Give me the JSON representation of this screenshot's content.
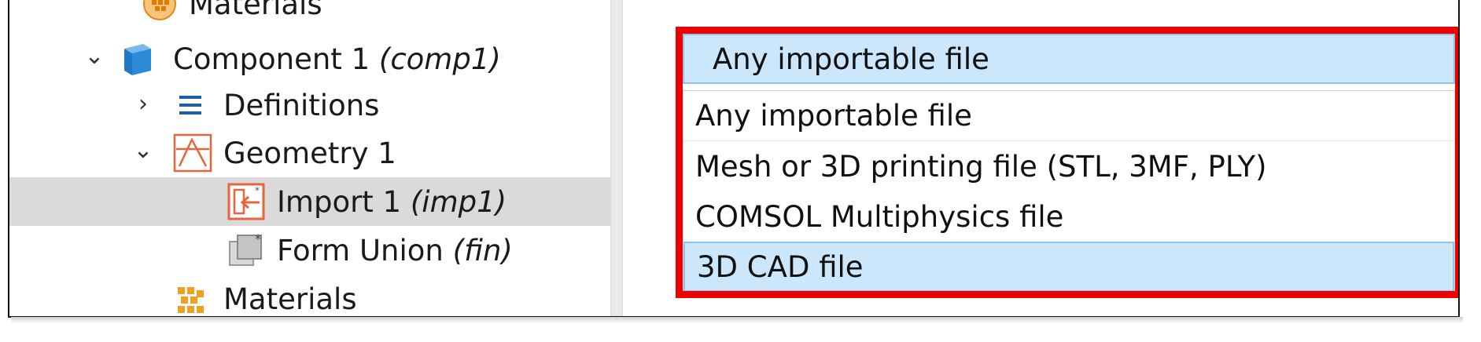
{
  "tree": {
    "items": [
      {
        "label": "Materials",
        "suffix": ""
      },
      {
        "label": "Component 1",
        "suffix": "(comp1)"
      },
      {
        "label": "Definitions",
        "suffix": ""
      },
      {
        "label": "Geometry 1",
        "suffix": ""
      },
      {
        "label": "Import 1",
        "suffix": "(imp1)"
      },
      {
        "label": "Form Union",
        "suffix": "(fin)"
      },
      {
        "label": "Materials",
        "suffix": ""
      }
    ],
    "arrows": {
      "expanded": "⌄",
      "collapsed": "›"
    }
  },
  "filetype": {
    "selected": "Any importable file",
    "options": [
      "Any importable file",
      "Mesh or 3D printing file (STL, 3MF, PLY)",
      "COMSOL Multiphysics file",
      "3D CAD file"
    ],
    "highlighted_index": 3
  },
  "colors": {
    "highlight": "#ef0000",
    "selection_blue": "#cce6fb",
    "tree_selected": "#dadada",
    "geometry_icon": "#e8643c",
    "component_icon": "#1f78c8",
    "materials_icon": "#f0a020"
  }
}
